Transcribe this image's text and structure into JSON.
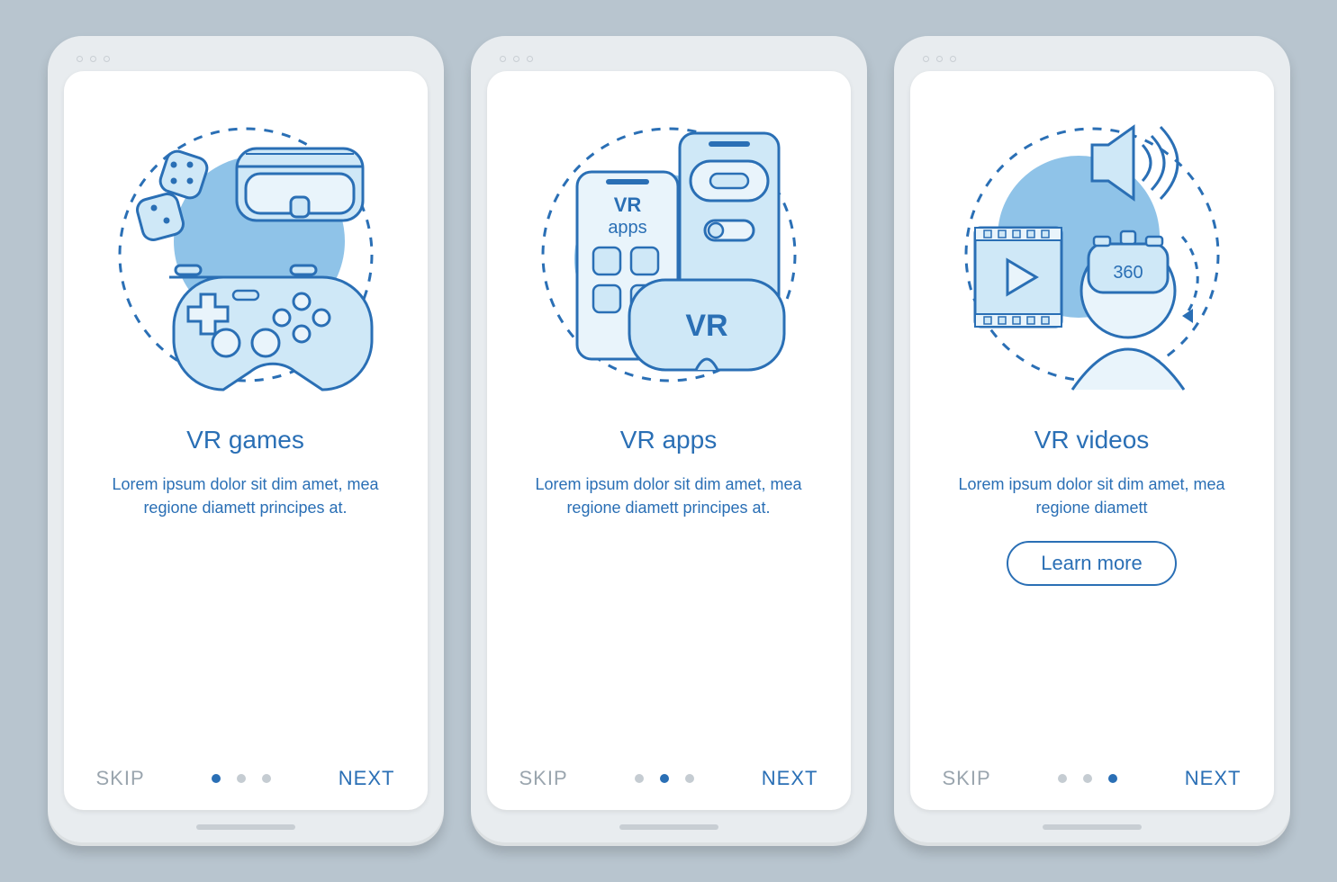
{
  "common": {
    "skip": "SKIP",
    "next": "NEXT",
    "learn_more": "Learn more",
    "desc3": "Lorem ipsum dolor sit dim amet, mea regione diamett principes at.",
    "desc2": "Lorem ipsum dolor sit dim amet, mea regione diamett"
  },
  "screens": [
    {
      "title": "VR games",
      "desc_key": "desc3",
      "active_dot": 0,
      "learn_more": false,
      "illus": "games"
    },
    {
      "title": "VR apps",
      "desc_key": "desc3",
      "active_dot": 1,
      "learn_more": false,
      "illus": "apps"
    },
    {
      "title": "VR videos",
      "desc_key": "desc2",
      "active_dot": 2,
      "learn_more": true,
      "illus": "videos"
    }
  ],
  "illus_labels": {
    "vr_apps_text": "VR\napps",
    "vr_text": "VR",
    "deg360": "360"
  }
}
